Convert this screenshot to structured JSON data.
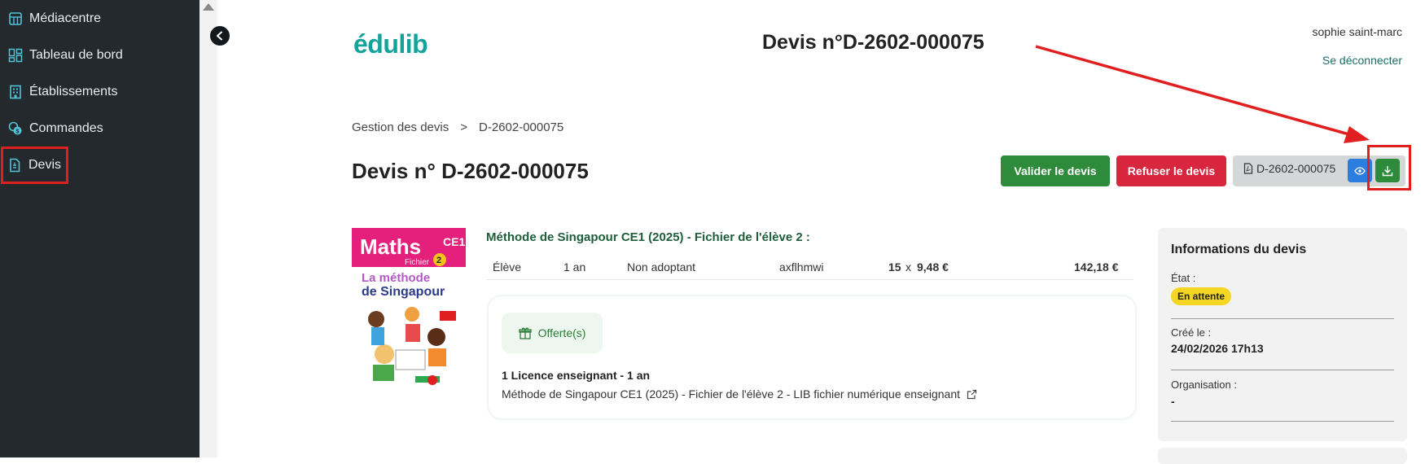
{
  "sidebar": {
    "items": [
      {
        "label": "Médiacentre",
        "icon": "calculator-icon"
      },
      {
        "label": "Tableau de bord",
        "icon": "dashboard-icon"
      },
      {
        "label": "Établissements",
        "icon": "building-icon"
      },
      {
        "label": "Commandes",
        "icon": "coins-icon"
      },
      {
        "label": "Devis",
        "icon": "document-icon"
      }
    ]
  },
  "header": {
    "logo": "édulib",
    "title": "Devis n°D-2602-000075",
    "user_name": "sophie saint-marc",
    "logout": "Se déconnecter"
  },
  "breadcrumb": {
    "parent": "Gestion des devis",
    "separator": ">",
    "current": "D-2602-000075"
  },
  "page": {
    "title": "Devis n° D-2602-000075"
  },
  "actions": {
    "validate_label": "Valider le devis",
    "refuse_label": "Refuser le devis",
    "pdf_label": "D-2602-000075"
  },
  "product": {
    "title": "Méthode de Singapour CE1 (2025) - Fichier de l'élève 2 :",
    "cover": {
      "maths": "Maths",
      "grade": "CE1",
      "fichier": "Fichier",
      "number": "2",
      "line1": "La méthode",
      "line2": "de Singapour"
    },
    "row": {
      "type": "Élève",
      "duration": "1 an",
      "adoption": "Non adoptant",
      "code": "axflhmwi",
      "qty": "15",
      "times": "x",
      "unit_price": "9,48 €",
      "total": "142,18 €"
    }
  },
  "offer": {
    "chip_label": "Offerte(s)",
    "line1": "1 Licence  enseignant - 1 an",
    "line2": "Méthode de Singapour CE1 (2025) - Fichier de l'élève 2 - LIB fichier numérique enseignant"
  },
  "info": {
    "title": "Informations du devis",
    "state_label": "État :",
    "state_value": "En attente",
    "created_label": "Créé le :",
    "created_value": "24/02/2026 17h13",
    "org_label": "Organisation :",
    "org_value": "-"
  },
  "colors": {
    "accent": "#13a39a",
    "validate": "#2e8b3c",
    "refuse": "#d7263d",
    "annotation": "#e02020"
  }
}
